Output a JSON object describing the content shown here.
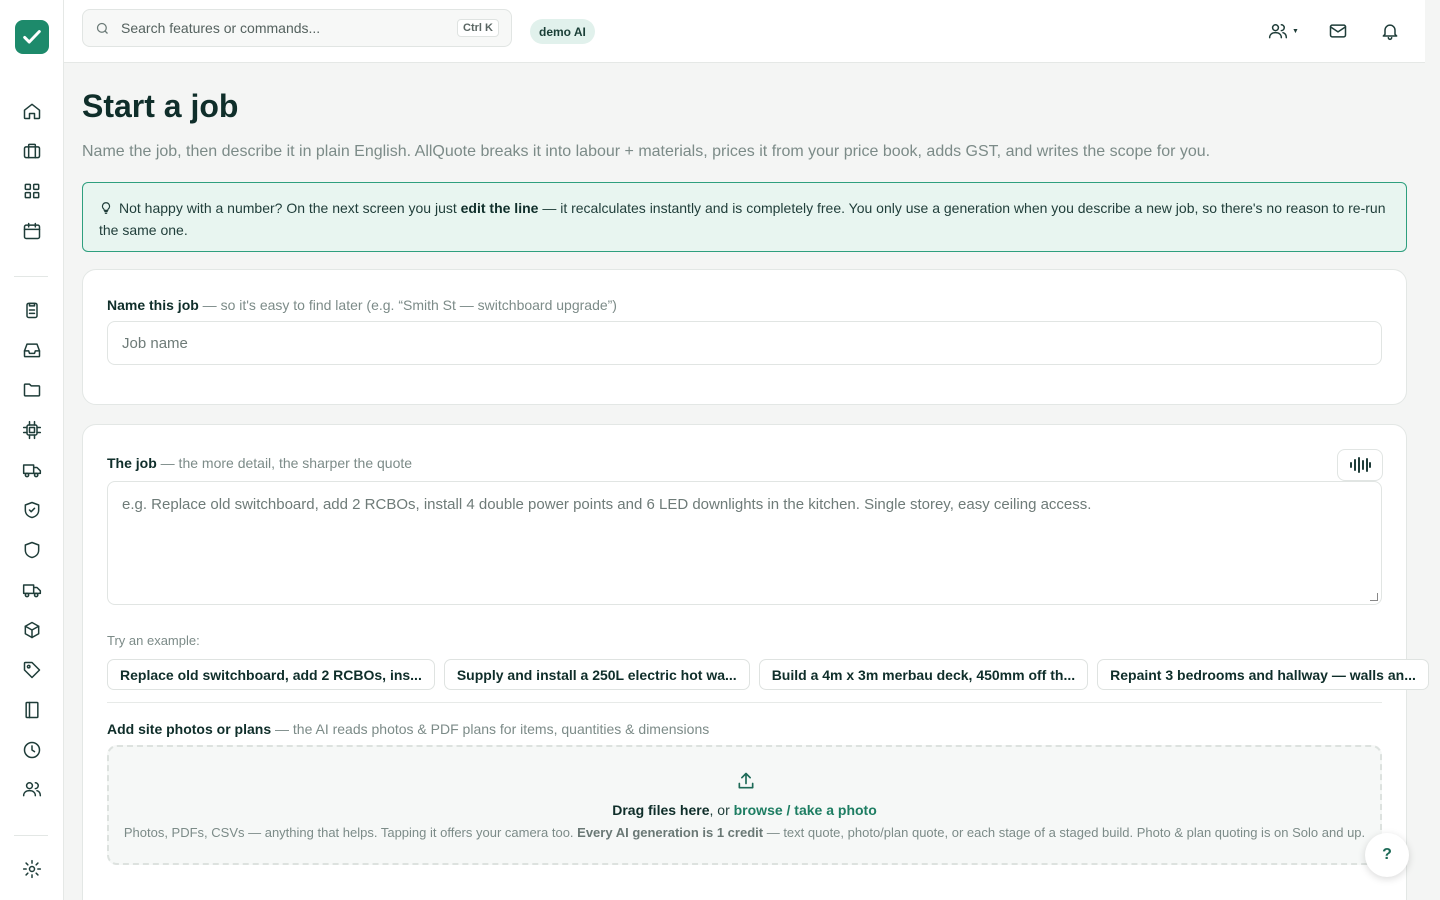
{
  "topbar": {
    "search_placeholder": "Search features or commands...",
    "search_shortcut": "Ctrl K",
    "demo_badge": "demo AI"
  },
  "page": {
    "title": "Start a job",
    "subtitle": "Name the job, then describe it in plain English. AllQuote breaks it into labour + materials, prices it from your price book, adds GST, and writes the scope for you."
  },
  "tip": {
    "prefix": "Not happy with a number? On the next screen you just ",
    "bold": "edit the line",
    "suffix": " — it recalculates instantly and is completely free. You only use a generation when you describe a new job, so there's no reason to re-run the same one."
  },
  "job_name": {
    "label": "Name this job",
    "hint": " — so it's easy to find later (e.g. “Smith St — switchboard upgrade”)",
    "placeholder": "Job name"
  },
  "job_desc": {
    "label": "The job",
    "hint": " — the more detail, the sharper the quote",
    "placeholder": "e.g. Replace old switchboard, add 2 RCBOs, install 4 double power points and 6 LED downlights in the kitchen. Single storey, easy ceiling access."
  },
  "examples": {
    "label": "Try an example:",
    "items": [
      "Replace old switchboard, add 2 RCBOs, ins...",
      "Supply and install a 250L electric hot wa...",
      "Build a 4m x 3m merbau deck, 450mm off th...",
      "Repaint 3 bedrooms and hallway — walls an..."
    ]
  },
  "photos": {
    "label": "Add site photos or plans",
    "hint": " — the AI reads photos & PDF plans for items, quantities & dimensions",
    "drop_bold": "Drag files here",
    "drop_sep": ", or ",
    "drop_link": "browse / take a photo",
    "note_prefix": "Photos, PDFs, CSVs — anything that helps. Tapping it offers your camera too. ",
    "note_bold": "Every AI generation is 1 credit",
    "note_suffix": " — text quote, photo/plan quote, or each stage of a staged build. Photo & plan quoting is on Solo and up."
  },
  "help_label": "?",
  "colors": {
    "accent": "#1d8a6b",
    "tip_bg": "#e8f5f0",
    "tip_border": "#2e9f7e"
  },
  "icons": [
    "check-logo-icon",
    "home-icon",
    "briefcase-icon",
    "grid-icon",
    "calendar-icon",
    "clipboard-icon",
    "inbox-icon",
    "folder-icon",
    "chip-icon",
    "truck-icon",
    "shield-check-icon",
    "shield-icon",
    "delivery-truck-icon",
    "box-icon",
    "tag-icon",
    "book-icon",
    "clock-icon",
    "users-icon",
    "settings-icon",
    "team-icon",
    "mail-icon",
    "bell-icon",
    "search-icon",
    "upload-icon",
    "waveform-icon",
    "lightbulb-icon"
  ]
}
